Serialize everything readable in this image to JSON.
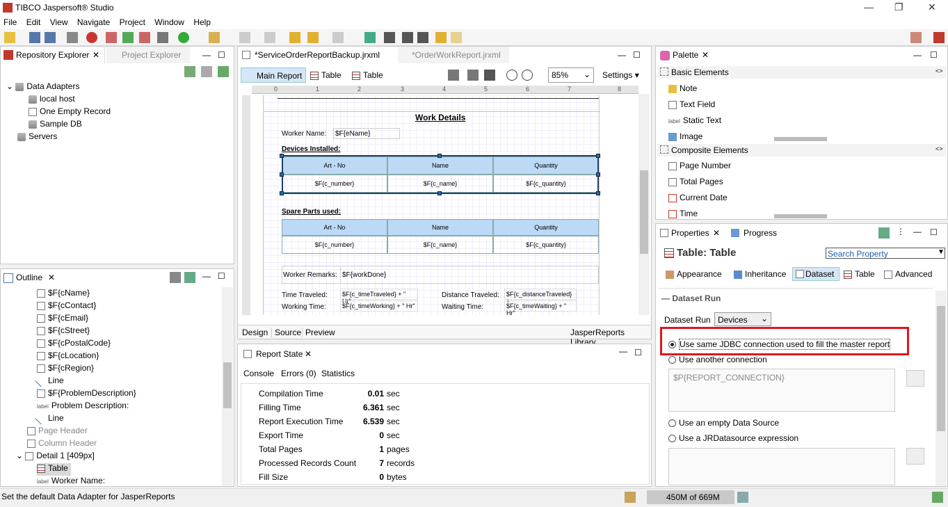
{
  "window": {
    "title": "TIBCO Jaspersoft® Studio"
  },
  "menu": [
    "File",
    "Edit",
    "View",
    "Navigate",
    "Project",
    "Window",
    "Help"
  ],
  "left_top": {
    "tabs": {
      "active": "Repository Explorer",
      "inactive": "Project Explorer"
    },
    "tree": {
      "data_adapters": "Data Adapters",
      "local_host": "local host",
      "one_empty": "One Empty Record",
      "sample_db": "Sample DB",
      "servers": "Servers"
    }
  },
  "outline": {
    "title": "Outline",
    "items": [
      "$F{cName}",
      "$F{cContact}",
      "$F{cEmail}",
      "$F{cStreet}",
      "$F{cPostalCode}",
      "$F{cLocation}",
      "$F{cRegion}",
      "Line",
      "$F{ProblemDescription}",
      "Problem Description:",
      "Line",
      "Page Header",
      "Column Header",
      "Detail 1 [409px]",
      "Table",
      "Worker Name:"
    ]
  },
  "editor": {
    "tabs": {
      "active": "*ServiceOrderReportBackup.jrxml",
      "inactive": "*OrderWorkReport.jrxml"
    },
    "subtabs": [
      "Main Report",
      "Table",
      "Table"
    ],
    "zoom": "85%",
    "settings": "Settings",
    "bottom_tabs": [
      "Design",
      "Source",
      "Preview"
    ],
    "library": "JasperReports Library",
    "report": {
      "title": "Work Details",
      "worker_name_label": "Worker Name:",
      "worker_name_field": "$F{eName}",
      "devices_installed": "Devices Installed:",
      "spare_parts": "Spare Parts used:",
      "col_art": "Art - No",
      "col_name": "Name",
      "col_qty": "Quantity",
      "val_number": "$F{c_number}",
      "val_name": "$F{c_name}",
      "val_qty": "$F{c_quantity}",
      "remarks_label": "Worker Remarks:",
      "remarks_field": "$F{workDone}",
      "time_traveled_label": "Time Traveled:",
      "time_traveled_field": "$F{c_timeTraveled} + \" Hr\"",
      "distance_label": "Distance Traveled:",
      "distance_field": "$F{c_distanceTraveled} +",
      "working_label": "Working Time:",
      "working_field": "$F{c_timeWorking} + \" Hr\"",
      "waiting_label": "Waiting Time:",
      "waiting_field": "$F{c_timeWaiting} + \" Hr\""
    }
  },
  "report_state": {
    "title": "Report State",
    "tabs": [
      "Console",
      "Errors (0)",
      "Statistics"
    ],
    "stats": [
      {
        "label": "Compilation Time",
        "value": "0.01",
        "unit": "sec"
      },
      {
        "label": "Filling Time",
        "value": "6.361",
        "unit": "sec"
      },
      {
        "label": "Report Execution Time",
        "value": "6.539",
        "unit": "sec"
      },
      {
        "label": "Export Time",
        "value": "0",
        "unit": "sec"
      },
      {
        "label": "Total Pages",
        "value": "1",
        "unit": "pages"
      },
      {
        "label": "Processed Records Count",
        "value": "7",
        "unit": "records"
      },
      {
        "label": "Fill Size",
        "value": "0",
        "unit": "bytes"
      }
    ]
  },
  "palette": {
    "title": "Palette",
    "basic": "Basic Elements",
    "basic_items": [
      "Note",
      "Text Field",
      "Static Text",
      "Image"
    ],
    "composite": "Composite Elements",
    "composite_items": [
      "Page Number",
      "Total Pages",
      "Current Date",
      "Time"
    ],
    "label_glyph": "label"
  },
  "properties": {
    "tabs": {
      "active": "Properties",
      "inactive": "Progress"
    },
    "heading": "Table: Table",
    "search_placeholder": "Search Property",
    "subtabs": [
      "Appearance",
      "Inheritance",
      "Dataset",
      "Table",
      "Advanced"
    ],
    "section": "Dataset Run",
    "dataset_run_label": "Dataset Run",
    "dataset_value": "Devices",
    "options": {
      "same_jdbc": "Use same JDBC connection used to fill the master report",
      "another": "Use another connection",
      "connection_expr": "$P{REPORT_CONNECTION}",
      "empty_ds": "Use an empty Data Source",
      "jrds": "Use a JRDatasource expression"
    },
    "highlight_color": "#e0161e"
  },
  "status": {
    "message": "Set the default Data Adapter for JasperReports",
    "memory": "450M of 669M"
  }
}
